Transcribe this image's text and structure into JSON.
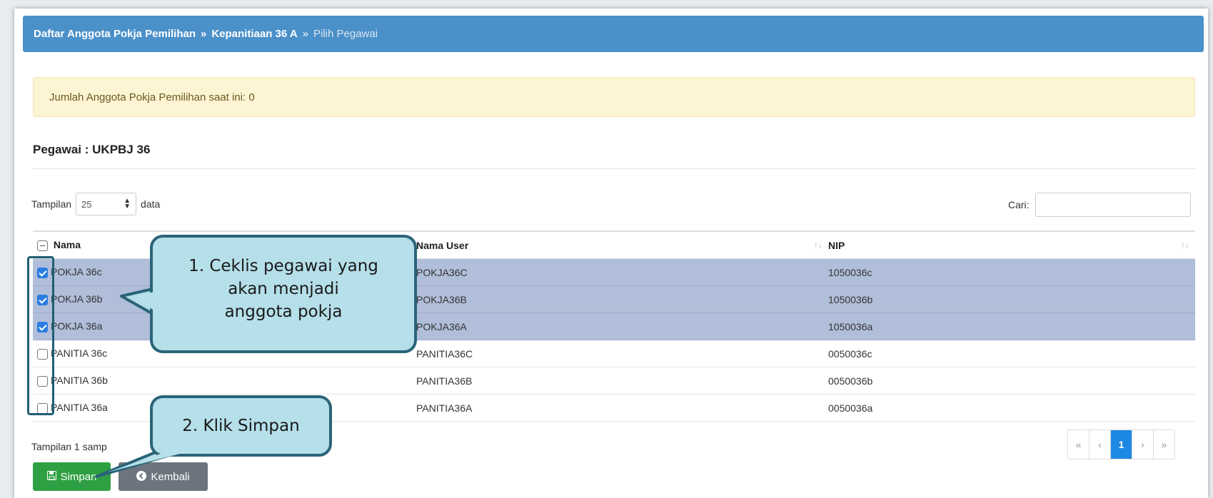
{
  "breadcrumb": {
    "items": [
      "Daftar Anggota Pokja Pemilihan",
      "Kepanitiaan 36 A"
    ],
    "separator": "»",
    "current": "Pilih Pegawai"
  },
  "alert_text": "Jumlah Anggota Pokja Pemilihan saat ini: 0",
  "section_title": "Pegawai : UKPBJ 36",
  "length_control": {
    "prefix": "Tampilan",
    "value": "25",
    "suffix": "data"
  },
  "search": {
    "label": "Cari:",
    "value": ""
  },
  "table": {
    "headers": [
      "Nama",
      "Nama User",
      "NIP"
    ],
    "rows": [
      {
        "nama": "POKJA 36c",
        "user": "POKJA36C",
        "nip": "1050036c",
        "checked": true
      },
      {
        "nama": "POKJA 36b",
        "user": "POKJA36B",
        "nip": "1050036b",
        "checked": true
      },
      {
        "nama": "POKJA 36a",
        "user": "POKJA36A",
        "nip": "1050036a",
        "checked": true
      },
      {
        "nama": "PANITIA 36c",
        "user": "PANITIA36C",
        "nip": "0050036c",
        "checked": false
      },
      {
        "nama": "PANITIA 36b",
        "user": "PANITIA36B",
        "nip": "0050036b",
        "checked": false
      },
      {
        "nama": "PANITIA 36a",
        "user": "PANITIA36A",
        "nip": "0050036a",
        "checked": false
      }
    ]
  },
  "info_text": "Tampilan 1 samp",
  "pagination": {
    "first": "«",
    "prev": "‹",
    "page": "1",
    "next": "›",
    "last": "»"
  },
  "buttons": {
    "save": "Simpan",
    "back": "Kembali"
  },
  "callouts": {
    "step1_lines": [
      "1.  Ceklis pegawai yang",
      "akan menjadi",
      "anggota pokja"
    ],
    "step2": "2. Klik Simpan"
  },
  "colors": {
    "header_bar": "#4a90c9",
    "selected_row": "#b0bed9",
    "save_button": "#2ea043",
    "callout_fill": "#b5dfe9",
    "callout_border": "#2a6479"
  }
}
